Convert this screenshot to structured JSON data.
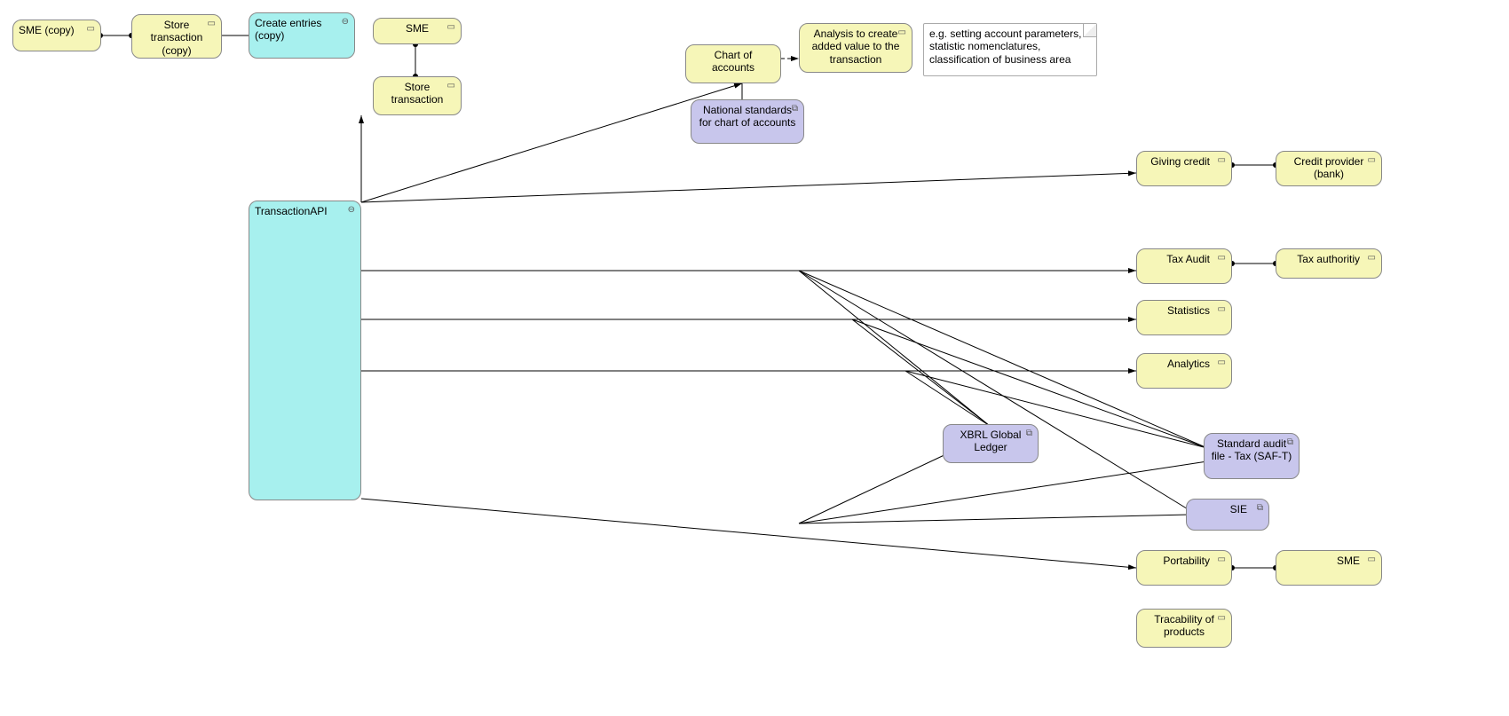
{
  "nodes": {
    "sme_copy": "SME (copy)",
    "store_tx_copy": "Store transaction (copy)",
    "create_entries_copy": "Create entries (copy)",
    "sme_top": "SME",
    "store_tx": "Store transaction",
    "transaction_api": "TransactionAPI",
    "chart_of_accounts": "Chart of accounts",
    "analysis": "Analysis to create added value to the transaction",
    "note_text": "e.g. setting account parameters, statistic nomenclatures, classification of business area",
    "nat_standards": "National standards for chart of accounts",
    "giving_credit": "Giving credit",
    "credit_provider": "Credit provider (bank)",
    "tax_audit": "Tax Audit",
    "tax_authority": "Tax authoritiy",
    "statistics": "Statistics",
    "analytics": "Analytics",
    "xbrl": "XBRL Global Ledger",
    "saf_t": "Standard audit file - Tax (SAF-T)",
    "sie": "SIE",
    "portability": "Portability",
    "sme_bottom": "SME",
    "traceability": "Tracability of products"
  },
  "icons": {
    "process": "▭",
    "service": "⊖",
    "object": "⧉"
  }
}
